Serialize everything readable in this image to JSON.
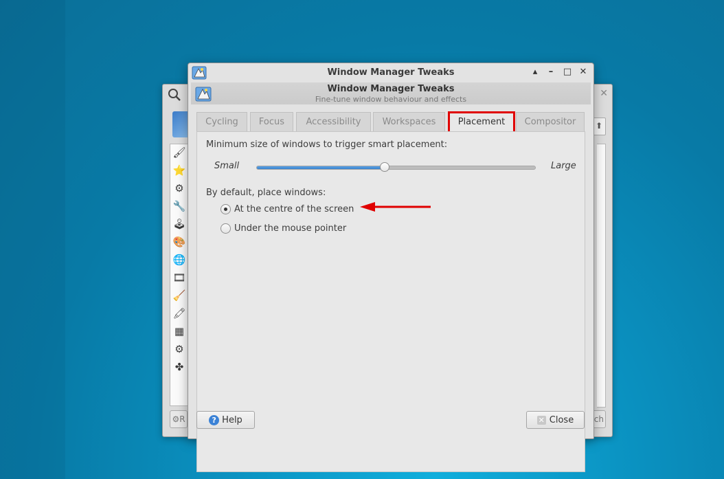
{
  "colors": {
    "accent": "#3a82cc",
    "highlight_box": "#e00000",
    "arrow": "#e00000"
  },
  "back_window": {
    "search_icon": "magnifier-icon",
    "close_icon": "close-icon",
    "left_button_icon": "gear-icon",
    "left_button_label": "R",
    "right_button_label": "ch"
  },
  "window": {
    "title": "Window Manager Tweaks",
    "controls": {
      "up": "▲",
      "minimize": "–",
      "maximize": "□",
      "close": "✕"
    },
    "header": {
      "title": "Window Manager Tweaks",
      "subtitle": "Fine-tune window behaviour and effects"
    }
  },
  "tabs": [
    {
      "label": "Cycling",
      "active": false
    },
    {
      "label": "Focus",
      "active": false
    },
    {
      "label": "Accessibility",
      "active": false
    },
    {
      "label": "Workspaces",
      "active": false
    },
    {
      "label": "Placement",
      "active": true
    },
    {
      "label": "Compositor",
      "active": false
    }
  ],
  "placement": {
    "smart_label": "Minimum size of windows to trigger smart placement:",
    "slider_min_label": "Small",
    "slider_max_label": "Large",
    "slider_value": 0.46,
    "default_label": "By default, place windows:",
    "options": [
      {
        "label": "At the centre of the screen",
        "checked": true
      },
      {
        "label": "Under the mouse pointer",
        "checked": false
      }
    ]
  },
  "buttons": {
    "help": "Help",
    "close": "Close",
    "help_icon": "?",
    "close_icon": "✕"
  }
}
